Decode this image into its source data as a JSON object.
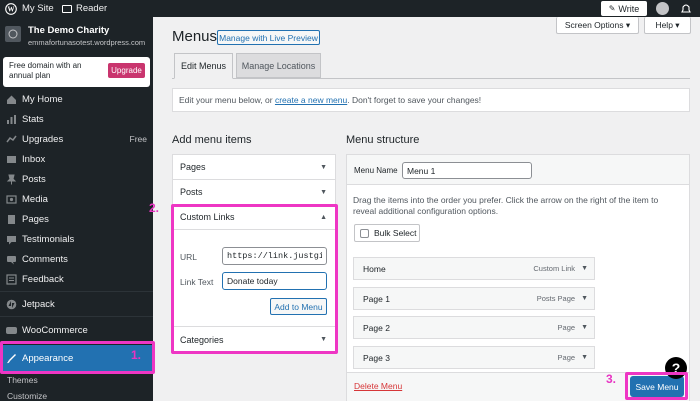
{
  "topbar": {
    "my_site": "My Site",
    "reader": "Reader",
    "write": "Write"
  },
  "sidebar": {
    "site_name": "The Demo Charity",
    "site_url": "emmafortunasotest.wordpress.com",
    "promo_text": "Free domain with an annual plan",
    "upgrade_label": "Upgrade",
    "items": [
      {
        "label": "My Home",
        "icon": "home-icon"
      },
      {
        "label": "Stats",
        "icon": "stats-icon"
      },
      {
        "label": "Upgrades",
        "icon": "upgrades-icon",
        "badge": "Free"
      },
      {
        "label": "Inbox",
        "icon": "inbox-icon"
      },
      {
        "label": "Posts",
        "icon": "pin-icon"
      },
      {
        "label": "Media",
        "icon": "media-icon"
      },
      {
        "label": "Pages",
        "icon": "pages-icon"
      },
      {
        "label": "Testimonials",
        "icon": "testimonials-icon"
      },
      {
        "label": "Comments",
        "icon": "comments-icon"
      },
      {
        "label": "Feedback",
        "icon": "feedback-icon"
      },
      {
        "label": "Jetpack",
        "icon": "jetpack-icon"
      },
      {
        "label": "WooCommerce",
        "icon": "woocommerce-icon"
      },
      {
        "label": "Appearance",
        "icon": "brush-icon"
      }
    ],
    "sub_items": [
      "Themes",
      "Customize"
    ]
  },
  "header": {
    "title": "Menus",
    "live_preview": "Manage with Live Preview",
    "screen_options": "Screen Options ▾",
    "help": "Help ▾"
  },
  "tabs": [
    "Edit Menus",
    "Manage Locations"
  ],
  "notice": {
    "before": "Edit your menu below, or ",
    "link": "create a new menu",
    "after": ". Don't forget to save your changes!"
  },
  "add_items": {
    "title": "Add menu items",
    "sections": [
      "Pages",
      "Posts",
      "Custom Links",
      "Categories"
    ],
    "url_label": "URL",
    "url_value": "https://link.justgi",
    "link_text_label": "Link Text",
    "link_text_value": "Donate today",
    "add_button": "Add to Menu"
  },
  "structure": {
    "title": "Menu structure",
    "menu_name_label": "Menu Name",
    "menu_name_value": "Menu 1",
    "instructions": "Drag the items into the order you prefer. Click the arrow on the right of the item to reveal additional configuration options.",
    "bulk_select": "Bulk Select",
    "items": [
      {
        "name": "Home",
        "type": "Custom Link"
      },
      {
        "name": "Page 1",
        "type": "Posts Page"
      },
      {
        "name": "Page 2",
        "type": "Page"
      },
      {
        "name": "Page 3",
        "type": "Page"
      }
    ],
    "delete_menu": "Delete Menu",
    "save_menu": "Save Menu"
  },
  "annotations": [
    "1.",
    "2.",
    "3."
  ],
  "help_icon": "?",
  "colors": {
    "admin_bg": "#1d2327",
    "highlight": "#ee36c4",
    "accent": "#2271b1",
    "upgrade": "#c9356e"
  }
}
